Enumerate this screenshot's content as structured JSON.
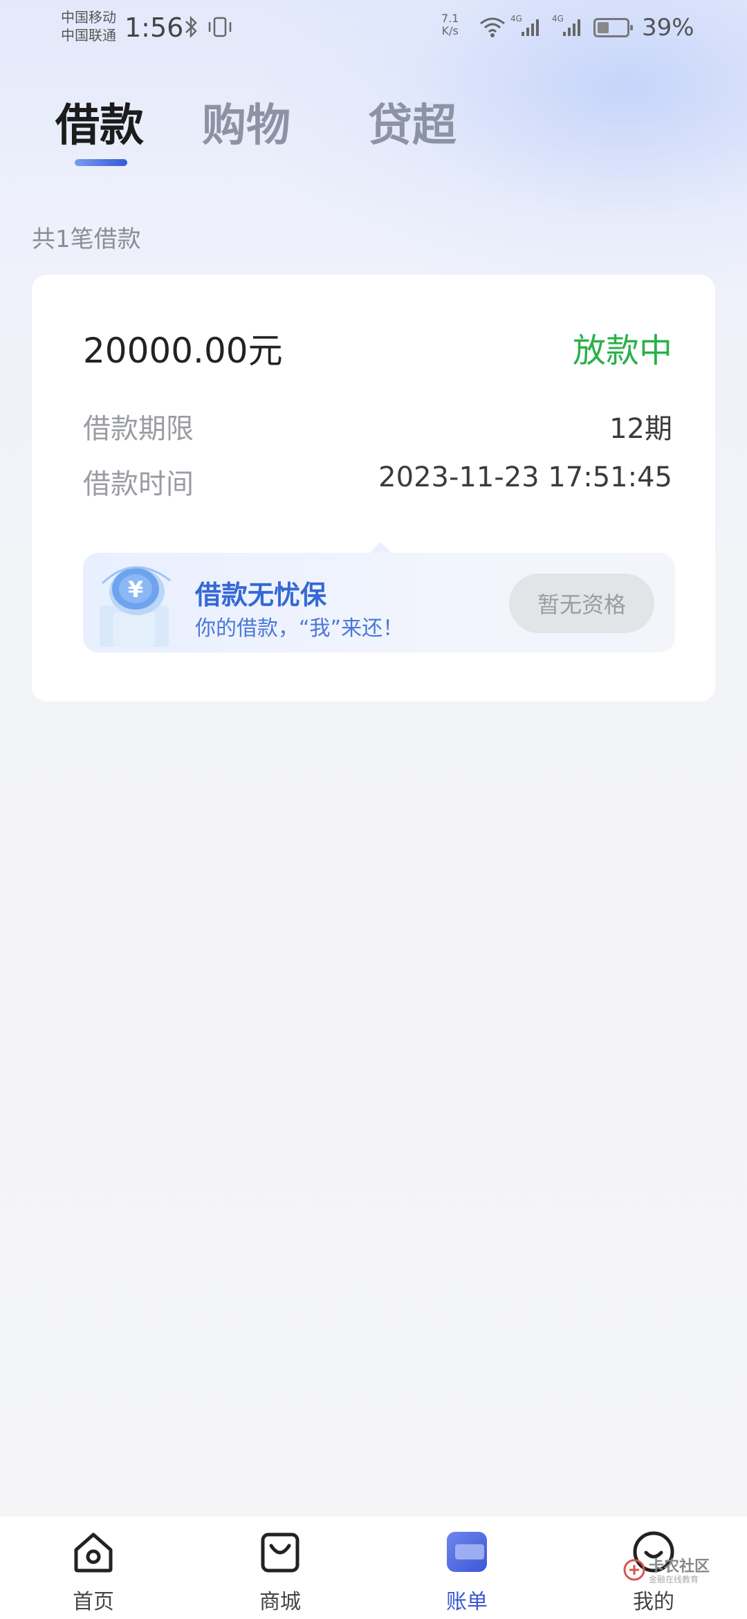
{
  "status_bar": {
    "carrier_1": "中国移动",
    "carrier_2": "中国联通",
    "time": "1:56",
    "net_speed_value": "7.1",
    "net_speed_unit": "K/s",
    "signal_tag_1": "4G",
    "signal_tag_2": "4G",
    "battery_percent": "39%",
    "battery_level": 0.39,
    "icons": [
      "bluetooth-icon",
      "vibrate-icon",
      "wifi-icon",
      "signal-icon",
      "battery-icon"
    ]
  },
  "tabs": [
    {
      "label": "借款",
      "active": true
    },
    {
      "label": "购物",
      "active": false
    },
    {
      "label": "贷超",
      "active": false
    }
  ],
  "summary": "共1笔借款",
  "loan_card": {
    "amount": "20000.00元",
    "status": "放款中",
    "term_label": "借款期限",
    "term_value": "12期",
    "time_label": "借款时间",
    "time_value": "2023-11-23 17:51:45",
    "insurance": {
      "title": "借款无忧保",
      "subtitle": "你的借款，“我”来还！",
      "button": "暂无资格",
      "icon": "yuan-coin-icon"
    }
  },
  "bottom_nav": [
    {
      "label": "首页",
      "icon": "home-icon",
      "active": false
    },
    {
      "label": "商城",
      "icon": "shopping-bag-icon",
      "active": false
    },
    {
      "label": "账单",
      "icon": "bill-icon",
      "active": true
    },
    {
      "label": "我的",
      "icon": "profile-icon",
      "active": false
    }
  ],
  "watermark": {
    "text": "卡农社区",
    "sub": "金融在线教育"
  },
  "colors": {
    "accent_blue": "#3a57d0",
    "status_green": "#2ab14a",
    "inactive_tab": "#8d93a5"
  }
}
